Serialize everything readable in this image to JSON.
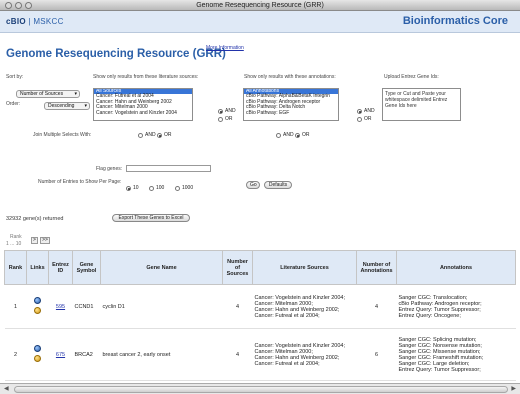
{
  "window": {
    "title": "Genome Resequencing Resource (GRR)"
  },
  "banner": {
    "logo_part1": "cBIO",
    "logo_part2": "MSKCC",
    "brand": "Bioinformatics Core"
  },
  "page": {
    "title": "Genome Resequencing Resource (GRR)",
    "more_info": "More Information"
  },
  "sort": {
    "label": "Sort by:",
    "field_value": "Number of Sources",
    "order_label": "Order:",
    "order_value": "Descending"
  },
  "literature": {
    "label": "Show only results from these literature sources:",
    "items": [
      "All Sources",
      "Cancer: Futreal et al 2004",
      "Cancer: Hahn and Weinberg 2002",
      "Cancer: Mitelman 2000",
      "Cancer: Vogelstein and Kinzler 2004"
    ],
    "and_label": "AND",
    "or_label": "OR"
  },
  "annotations": {
    "label": "Show only results with these annotations:",
    "items": [
      "All Annotations",
      "cBio Pathway: AlphaB&BetaK Integrin",
      "cBio Pathway: Androgen receptor",
      "cBio Pathway: Delta Notch",
      "cBio Pathway: EGF"
    ],
    "and_label": "AND",
    "or_label": "OR"
  },
  "upload": {
    "label": "Upload Entrez Gene Ids:",
    "placeholder": "Type or Cut and Paste your whitespace delimited Entrez Gene Ids here"
  },
  "join": {
    "label": "Join Multiple Selects With:",
    "and_label": "AND",
    "or_label": "OR"
  },
  "join2": {
    "and_label": "AND",
    "or_label": "OR"
  },
  "flag": {
    "label": "Flag genes:"
  },
  "entries": {
    "label": "Number of Entries to Show Per Page:",
    "options": [
      "10",
      "100",
      "1000"
    ]
  },
  "actions": {
    "go": "Go",
    "defaults": "Defaults"
  },
  "summary": {
    "returned": "32932 gene(s) returned",
    "export": "Export These Genes to Excel"
  },
  "pager": {
    "rank_label": "Rank",
    "range": "1 ... 10",
    "next": ">",
    "last": ">>"
  },
  "table": {
    "headers": [
      "Rank",
      "Links",
      "Entrez ID",
      "Gene Symbol",
      "Gene Name",
      "Number of Sources",
      "Literature Sources",
      "Number of Annotations",
      "Annotations"
    ],
    "rows": [
      {
        "rank": "1",
        "entrez": "595",
        "symbol": "CCND1",
        "name": "cyclin D1",
        "sources": "4",
        "literature": [
          "Cancer: Vogelstein and Kinzler 2004;",
          "Cancer: Mitelman 2000;",
          "Cancer: Hahn and Weinberg 2002;",
          "Cancer: Futreal et al 2004;"
        ],
        "annotations_count": "4",
        "annotations": [
          "Sanger CGC: Translocation;",
          "cBio Pathway: Androgen receptor;",
          "Entrez Query: Tumor Suppressor;",
          "Entrez Query: Oncogene;"
        ]
      },
      {
        "rank": "2",
        "entrez": "675",
        "symbol": "BRCA2",
        "name": "breast cancer 2, early onset",
        "sources": "4",
        "literature": [
          "Cancer: Vogelstein and Kinzler 2004;",
          "Cancer: Mitelman 2000;",
          "Cancer: Hahn and Weinberg 2002;",
          "Cancer: Futreal et al 2004;"
        ],
        "annotations_count": "6",
        "annotations": [
          "Sanger CGC: Splicing mutation;",
          "Sanger CGC: Nonsense mutation;",
          "Sanger CGC: Missense mutation;",
          "Sanger CGC: Frameshift mutation;",
          "Sanger CGC: Large deletion;",
          "Entrez Query: Tumor Suppressor;"
        ]
      }
    ]
  }
}
